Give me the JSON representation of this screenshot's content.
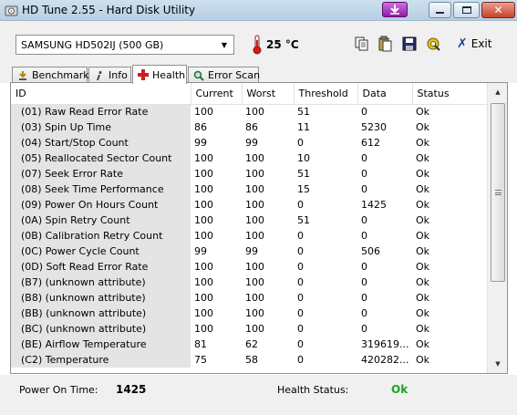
{
  "window": {
    "title": "HD Tune 2.55 - Hard Disk Utility",
    "app_icon": "disk-icon"
  },
  "toolbar": {
    "drive": "SAMSUNG HD502IJ (500 GB)",
    "temperature": "25 °C",
    "exit_label": "Exit"
  },
  "tabs": [
    {
      "label": "Benchmark",
      "icon": "benchmark-icon"
    },
    {
      "label": "Info",
      "icon": "info-icon"
    },
    {
      "label": "Health",
      "icon": "health-cross-icon",
      "active": true
    },
    {
      "label": "Error Scan",
      "icon": "magnifier-icon"
    }
  ],
  "health_table": {
    "columns": [
      "ID",
      "Current",
      "Worst",
      "Threshold",
      "Data",
      "Status"
    ],
    "rows": [
      [
        "(01) Raw Read Error Rate",
        "100",
        "100",
        "51",
        "0",
        "Ok"
      ],
      [
        "(03) Spin Up Time",
        "86",
        "86",
        "11",
        "5230",
        "Ok"
      ],
      [
        "(04) Start/Stop Count",
        "99",
        "99",
        "0",
        "612",
        "Ok"
      ],
      [
        "(05) Reallocated Sector Count",
        "100",
        "100",
        "10",
        "0",
        "Ok"
      ],
      [
        "(07) Seek Error Rate",
        "100",
        "100",
        "51",
        "0",
        "Ok"
      ],
      [
        "(08) Seek Time Performance",
        "100",
        "100",
        "15",
        "0",
        "Ok"
      ],
      [
        "(09) Power On Hours Count",
        "100",
        "100",
        "0",
        "1425",
        "Ok"
      ],
      [
        "(0A) Spin Retry Count",
        "100",
        "100",
        "51",
        "0",
        "Ok"
      ],
      [
        "(0B) Calibration Retry Count",
        "100",
        "100",
        "0",
        "0",
        "Ok"
      ],
      [
        "(0C) Power Cycle Count",
        "99",
        "99",
        "0",
        "506",
        "Ok"
      ],
      [
        "(0D) Soft Read Error Rate",
        "100",
        "100",
        "0",
        "0",
        "Ok"
      ],
      [
        "(B7) (unknown attribute)",
        "100",
        "100",
        "0",
        "0",
        "Ok"
      ],
      [
        "(B8) (unknown attribute)",
        "100",
        "100",
        "0",
        "0",
        "Ok"
      ],
      [
        "(BB) (unknown attribute)",
        "100",
        "100",
        "0",
        "0",
        "Ok"
      ],
      [
        "(BC) (unknown attribute)",
        "100",
        "100",
        "0",
        "0",
        "Ok"
      ],
      [
        "(BE) Airflow Temperature",
        "81",
        "62",
        "0",
        "319619...",
        "Ok"
      ],
      [
        "(C2) Temperature",
        "75",
        "58",
        "0",
        "420282...",
        "Ok"
      ]
    ]
  },
  "footer": {
    "power_on_label": "Power On Time:",
    "power_on_value": "1425",
    "health_label": "Health Status:",
    "health_value": "Ok",
    "health_color": "#1ba51b"
  }
}
